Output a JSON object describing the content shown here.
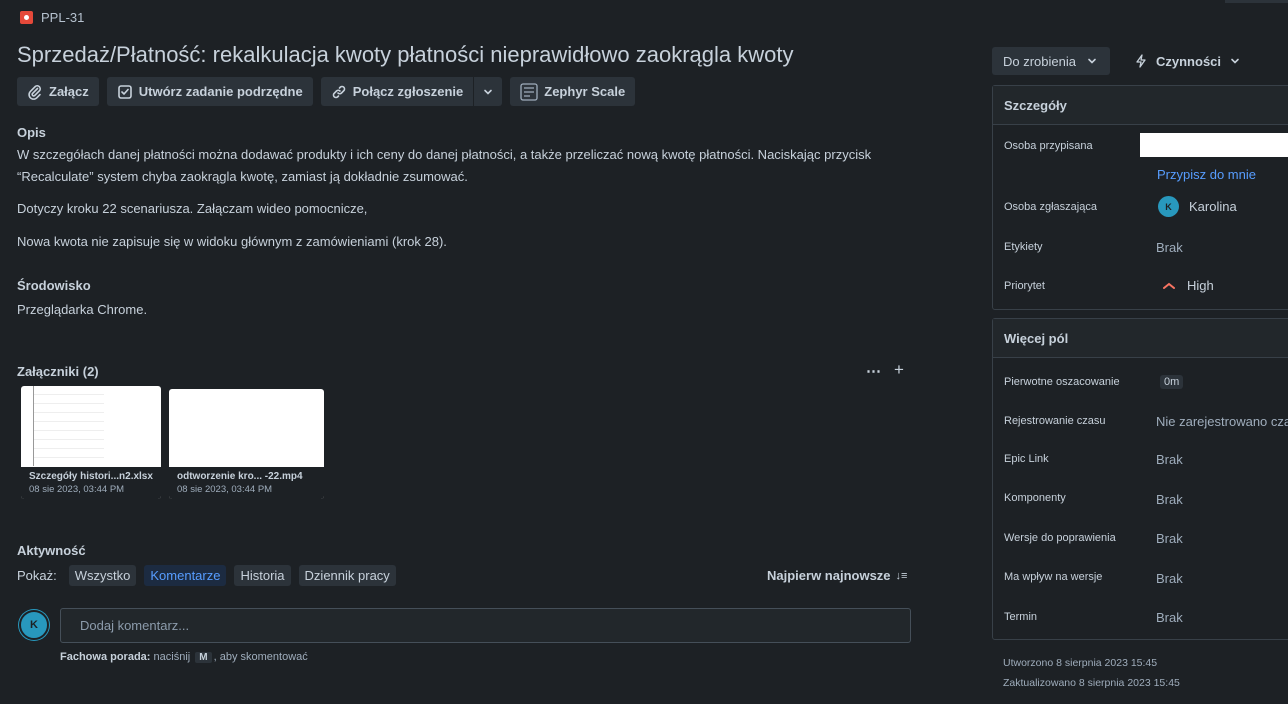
{
  "issue": {
    "key": "PPL-31",
    "title": "Sprzedaż/Płatność: rekalkulacja kwoty płatności nieprawidłowo zaokrągla kwoty"
  },
  "toolbar": {
    "attach": "Załącz",
    "subtask": "Utwórz zadanie podrzędne",
    "link": "Połącz zgłoszenie",
    "zephyr": "Zephyr Scale"
  },
  "description": {
    "heading": "Opis",
    "p1": "W szczegółach danej płatności można dodawać produkty i ich ceny do danej płatności, a także przeliczać nową kwotę płatności. Naciskając przycisk",
    "p1b": "“Recalculate” system chyba zaokrągla kwotę, zamiast ją dokładnie zsumować.",
    "p2": "Dotyczy kroku 22 scenariusza. Załączam wideo pomocnicze,",
    "p3": "Nowa kwota nie zapisuje się w widoku głównym z zamówieniami (krok 28)."
  },
  "environment": {
    "heading": "Środowisko",
    "text": "Przeglądarka Chrome."
  },
  "attachments": {
    "heading": "Załączniki (2)",
    "items": [
      {
        "name": "Szczegóły histori...n2.xlsx",
        "date": "08 sie 2023, 03:44 PM"
      },
      {
        "name": "odtworzenie kro... -22.mp4",
        "date": "08 sie 2023, 03:44 PM"
      }
    ]
  },
  "activity": {
    "heading": "Aktywność",
    "show_label": "Pokaż:",
    "tabs": [
      "Wszystko",
      "Komentarze",
      "Historia",
      "Dziennik pracy"
    ],
    "active_tab": "Komentarze",
    "sort_label": "Najpierw najnowsze",
    "user_initial": "K",
    "comment_placeholder": "Dodaj komentarz...",
    "tip_bold": "Fachowa porada:",
    "tip_pre": "naciśnij",
    "tip_key": "M",
    "tip_post": ", aby skomentować"
  },
  "sidebar": {
    "status": "Do zrobienia",
    "actions": "Czynności",
    "details": {
      "heading": "Szczegóły",
      "assignee_label": "Osoba przypisana",
      "assign_to_me": "Przypisz do mnie",
      "reporter_label": "Osoba zgłaszająca",
      "reporter_initial": "K",
      "reporter_name": "Karolina",
      "labels_label": "Etykiety",
      "labels_value": "Brak",
      "priority_label": "Priorytet",
      "priority_value": "High"
    },
    "more_fields": {
      "heading": "Więcej pól",
      "rows": [
        {
          "label": "Pierwotne oszacowanie",
          "value": "0m"
        },
        {
          "label": "Rejestrowanie czasu",
          "value": "Nie zarejestrowano czasu"
        },
        {
          "label": "Epic Link",
          "value": "Brak"
        },
        {
          "label": "Komponenty",
          "value": "Brak"
        },
        {
          "label": "Wersje do poprawienia",
          "value": "Brak"
        },
        {
          "label": "Ma wpływ na wersje",
          "value": "Brak"
        },
        {
          "label": "Termin",
          "value": "Brak"
        }
      ]
    },
    "created": "Utworzono 8 sierpnia 2023 15:45",
    "updated": "Zaktualizowano 8 sierpnia 2023 15:45"
  },
  "colors": {
    "background": "#1d2125",
    "accent": "#579dff",
    "bug": "#e5493a",
    "priority_high": "#f87462"
  }
}
